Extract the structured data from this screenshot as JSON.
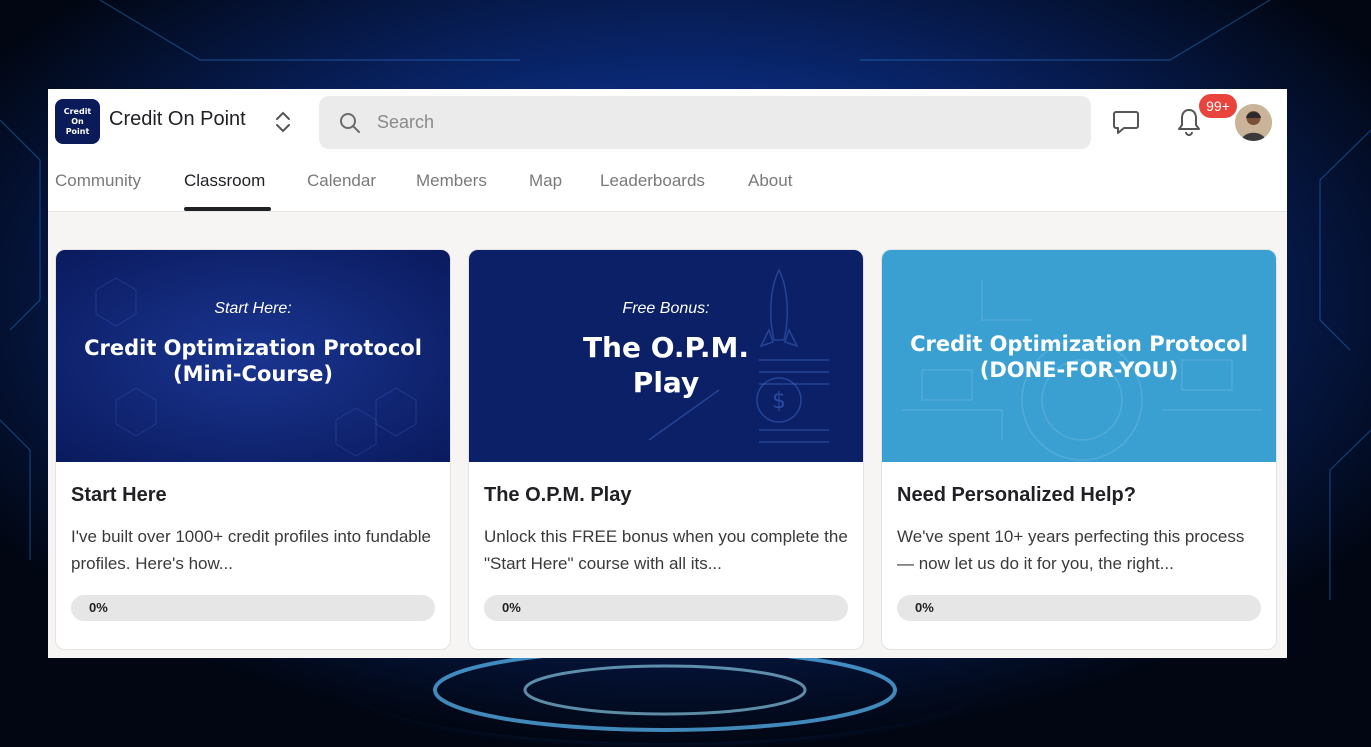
{
  "brand": {
    "logo_lines": [
      "Credit",
      "On",
      "Point"
    ],
    "name": "Credit On Point"
  },
  "search": {
    "placeholder": "Search"
  },
  "notifications": {
    "badge": "99+"
  },
  "tabs": [
    {
      "label": "Community"
    },
    {
      "label": "Classroom",
      "active": true
    },
    {
      "label": "Calendar"
    },
    {
      "label": "Members"
    },
    {
      "label": "Map"
    },
    {
      "label": "Leaderboards"
    },
    {
      "label": "About"
    }
  ],
  "courses": [
    {
      "cover_kicker": "Start Here:",
      "cover_title_1": "Credit Optimization Protocol",
      "cover_title_2": "(Mini-Course)",
      "title": "Start Here",
      "description": "I've built over 1000+ credit profiles into fundable profiles. Here's how...",
      "progress_label": "0%",
      "progress": 0
    },
    {
      "cover_kicker": "Free Bonus:",
      "cover_title_1": "The O.P.M.",
      "cover_title_2": "Play",
      "title": "The O.P.M. Play",
      "description": "Unlock this FREE bonus when you complete the \"Start Here\" course with all its...",
      "progress_label": "0%",
      "progress": 0
    },
    {
      "cover_title_1": "Credit Optimization Protocol",
      "cover_title_2": "(DONE-FOR-YOU)",
      "title": "Need Personalized Help?",
      "description": "We've spent 10+ years perfecting this process — now let us do it for you, the right...",
      "progress_label": "0%",
      "progress": 0
    }
  ],
  "colors": {
    "card1_cover": "#0a1f6b",
    "card2_cover": "#0b2066",
    "card3_cover": "#3aa0d2",
    "notification_badge": "#e8443b"
  }
}
